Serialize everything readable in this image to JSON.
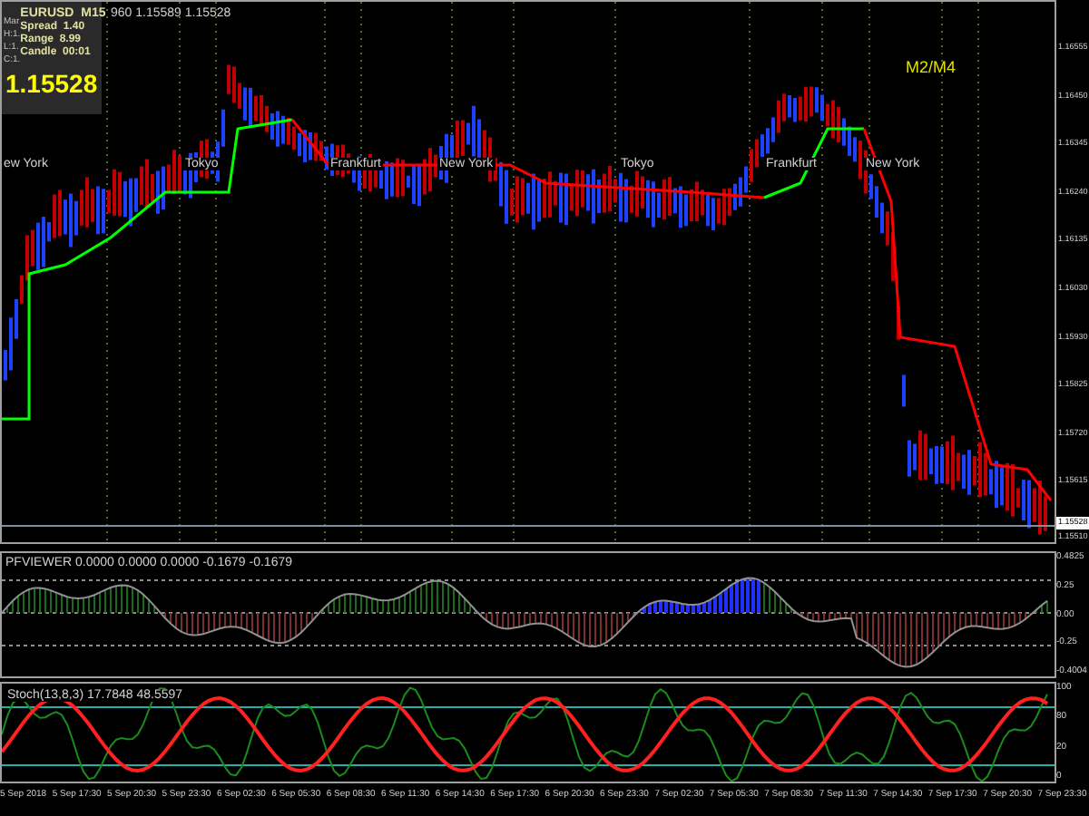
{
  "info_panel": {
    "symbol": "EURUSD  M15",
    "spread": "Spread  1.40",
    "range": "Range  8.99",
    "candle": "Candle  00:01",
    "price": "1.15528",
    "hidden_labels": [
      "Mar",
      "H:1.",
      "L:1.",
      "C:1."
    ]
  },
  "header": "960 1.15589 1.15528",
  "overlay_label": "M2/M4",
  "sessions": [
    {
      "label": "ew York"
    },
    {
      "label": "Tokyo"
    },
    {
      "label": "Frankfurt"
    },
    {
      "label": "New York"
    },
    {
      "label": "Tokyo"
    },
    {
      "label": "Frankfurt"
    },
    {
      "label": "New York"
    }
  ],
  "price_axis": [
    "1.16555",
    "1.16450",
    "1.16345",
    "1.16240",
    "1.16135",
    "1.16030",
    "1.15930",
    "1.15825",
    "1.15720",
    "1.15615",
    "1.15510"
  ],
  "current_price": "1.15528",
  "indicator": {
    "title": "PFVIEWER 0.0000 0.0000 0.0000 -0.1679 -0.1679",
    "axis": [
      "0.4825",
      "0.25",
      "0.00",
      "-0.25",
      "-0.4004"
    ]
  },
  "stochastic": {
    "title": "Stoch(13,8,3) 17.7848 48.5597",
    "axis": [
      "100",
      "80",
      "20",
      "0"
    ]
  },
  "time_axis": [
    "5 Sep 2018",
    "5 Sep 17:30",
    "5 Sep 20:30",
    "5 Sep 23:30",
    "6 Sep 02:30",
    "6 Sep 05:30",
    "6 Sep 08:30",
    "6 Sep 11:30",
    "6 Sep 14:30",
    "6 Sep 17:30",
    "6 Sep 20:30",
    "6 Sep 23:30",
    "7 Sep 02:30",
    "7 Sep 05:30",
    "7 Sep 08:30",
    "7 Sep 11:30",
    "7 Sep 14:30",
    "7 Sep 17:30",
    "7 Sep 20:30",
    "7 Sep 23:30"
  ]
}
